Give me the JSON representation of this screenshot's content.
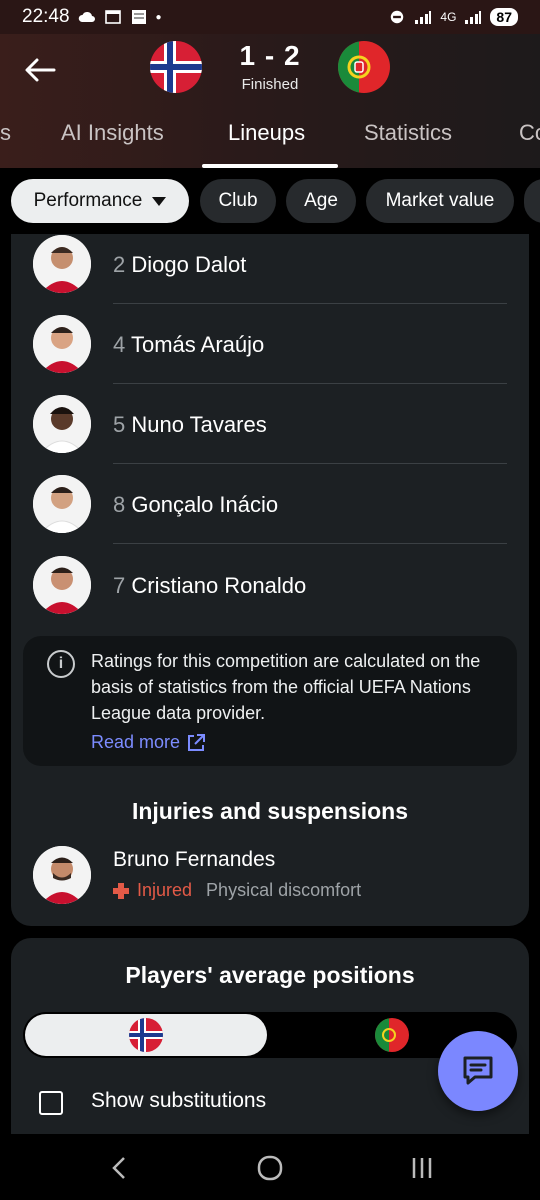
{
  "status_bar": {
    "time": "22:48",
    "battery": "87",
    "network": "4G"
  },
  "match": {
    "score": "1 - 2",
    "status": "Finished",
    "home_team": "Norway",
    "away_team": "Portugal"
  },
  "tabs": [
    {
      "label": "s"
    },
    {
      "label": "AI Insights"
    },
    {
      "label": "Lineups",
      "active": true
    },
    {
      "label": "Statistics"
    },
    {
      "label": "Co"
    }
  ],
  "filters": [
    {
      "label": "Performance",
      "selected": true
    },
    {
      "label": "Club"
    },
    {
      "label": "Age"
    },
    {
      "label": "Market value"
    }
  ],
  "players": [
    {
      "number": "2",
      "name": "Diogo Dalot"
    },
    {
      "number": "4",
      "name": "Tomás Araújo"
    },
    {
      "number": "5",
      "name": "Nuno Tavares"
    },
    {
      "number": "8",
      "name": "Gonçalo Inácio"
    },
    {
      "number": "7",
      "name": "Cristiano Ronaldo"
    }
  ],
  "info": {
    "text": "Ratings for this competition are calculated on the basis of statistics from the official UEFA Nations League data provider.",
    "read_more": "Read more"
  },
  "injuries": {
    "title": "Injuries and suspensions",
    "player": "Bruno Fernandes",
    "status": "Injured",
    "reason": "Physical discomfort"
  },
  "positions": {
    "title": "Players' average positions",
    "show_subs_label": "Show substitutions"
  },
  "colors": {
    "accent": "#7b87ff",
    "injury": "#e35a47",
    "card": "#1c2023"
  }
}
